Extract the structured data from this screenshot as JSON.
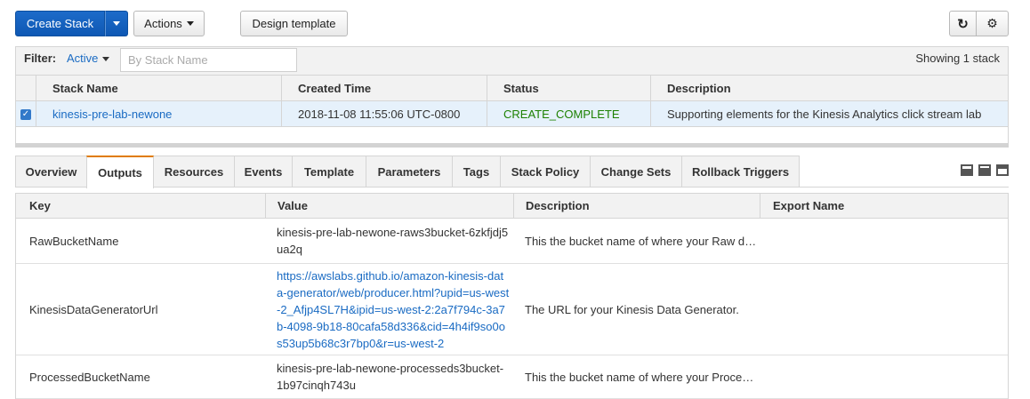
{
  "toolbar": {
    "create_stack": "Create Stack",
    "actions": "Actions",
    "design_template": "Design template",
    "refresh_icon": "refresh-icon",
    "settings_icon": "gear-icon"
  },
  "filter": {
    "label": "Filter:",
    "active": "Active",
    "placeholder": "By Stack Name",
    "showing": "Showing 1 stack"
  },
  "stacks": {
    "headers": [
      "Stack Name",
      "Created Time",
      "Status",
      "Description"
    ],
    "rows": [
      {
        "name": "kinesis-pre-lab-newone",
        "created": "2018-11-08 11:55:06 UTC-0800",
        "status": "CREATE_COMPLETE",
        "description": "Supporting elements for the Kinesis Analytics click stream lab",
        "selected": true
      }
    ]
  },
  "tabs": [
    "Overview",
    "Outputs",
    "Resources",
    "Events",
    "Template",
    "Parameters",
    "Tags",
    "Stack Policy",
    "Change Sets",
    "Rollback Triggers"
  ],
  "active_tab": "Outputs",
  "outputs": {
    "headers": [
      "Key",
      "Value",
      "Description",
      "Export Name"
    ],
    "rows": [
      {
        "key": "RawBucketName",
        "value": "kinesis-pre-lab-newone-raws3bucket-6zkfjdj5ua2q",
        "description": "This the bucket name of where your Raw d…",
        "export": ""
      },
      {
        "key": "KinesisDataGeneratorUrl",
        "value": "https://awslabs.github.io/amazon-kinesis-data-generator/web/producer.html?upid=us-west-2_Afjp4SL7H&ipid=us-west-2:2a7f794c-3a7b-4098-9b18-80cafa58d336&cid=4h4if9so0os53up5b68c3r7bp0&r=us-west-2",
        "description": "The URL for your Kinesis Data Generator.",
        "export": ""
      },
      {
        "key": "ProcessedBucketName",
        "value": "kinesis-pre-lab-newone-processeds3bucket-1b97cinqh743u",
        "description": "This the bucket name of where your Proce…",
        "export": ""
      }
    ]
  },
  "colors": {
    "primary": "#1d6bc9",
    "link": "#1a6bc3",
    "status_ok": "#1d8102",
    "active_tab_accent": "#e07b00",
    "selected_row": "#e6f1fb"
  }
}
